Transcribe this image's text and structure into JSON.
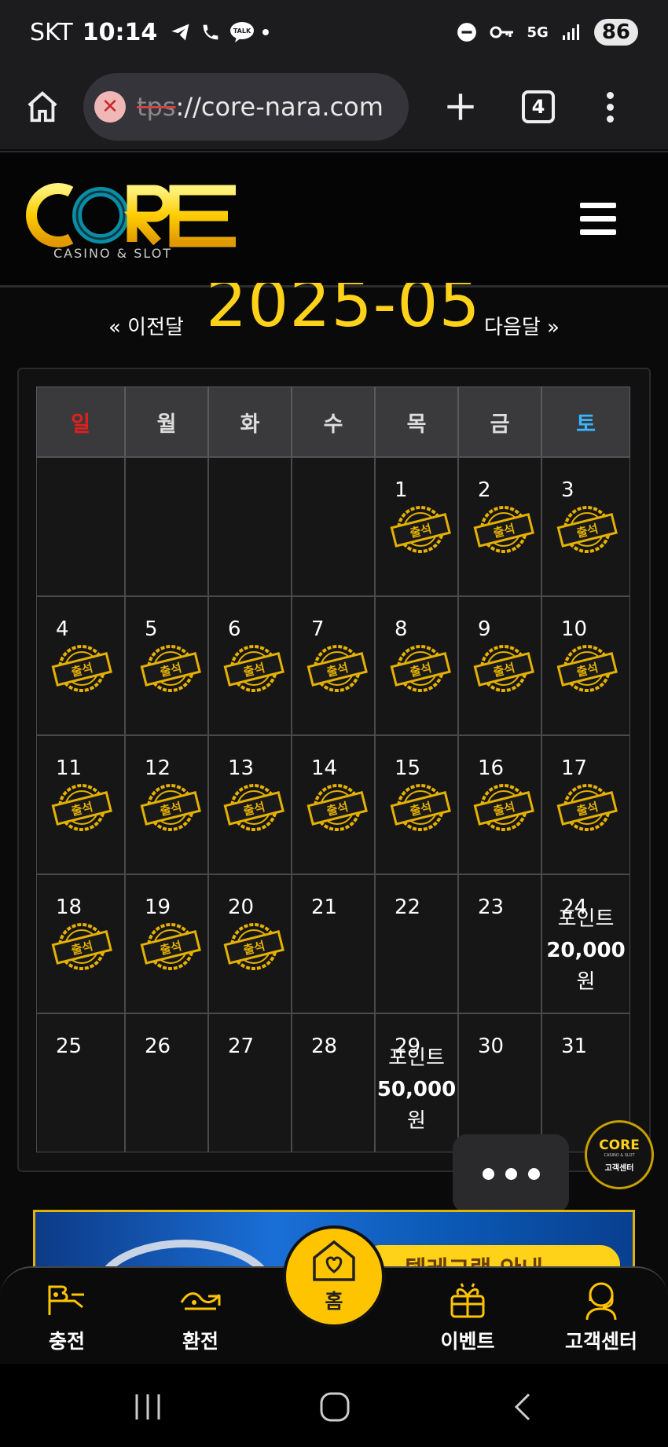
{
  "status_bar": {
    "carrier": "SKT",
    "time": "10:14",
    "network": "5G",
    "battery": "86"
  },
  "browser": {
    "url_faded": "tps",
    "url_main": "://core-nara.com",
    "tab_count": "4"
  },
  "site": {
    "logo_text": "CORE",
    "logo_subtitle": "CASINO & SLOT"
  },
  "calendar": {
    "prev_label": "« 이전달",
    "next_label": "다음달 »",
    "month_title": "2025-05",
    "weekdays": [
      "일",
      "월",
      "화",
      "수",
      "목",
      "금",
      "토"
    ],
    "weekday_colors": {
      "sunday": "#e0201e",
      "saturday": "#38b6ff",
      "default": "#dddddd"
    },
    "stamp_text": "출석",
    "days": [
      "1",
      "2",
      "3",
      "4",
      "5",
      "6",
      "7",
      "8",
      "9",
      "10",
      "11",
      "12",
      "13",
      "14",
      "15",
      "16",
      "17",
      "18",
      "19",
      "20",
      "21",
      "22",
      "23",
      "24",
      "25",
      "26",
      "27",
      "28",
      "29",
      "30",
      "31"
    ],
    "attended_through": 20,
    "rewards": {
      "24": {
        "label": "포인트",
        "amount": "20,000",
        "unit": "원"
      },
      "29": {
        "label": "포인트",
        "amount": "50,000",
        "unit": "원"
      }
    }
  },
  "floating": {
    "cs_badge_logo": "CORE",
    "cs_badge_sub": "CASINO & SLOT",
    "cs_badge_label": "고객센터"
  },
  "banner": {
    "text": "텔레그램 안내"
  },
  "bottom_nav": {
    "deposit": "충전",
    "withdraw": "환전",
    "home": "홈",
    "events": "이벤트",
    "support": "고객센터"
  },
  "colors": {
    "accent_gold": "#ffd21a",
    "background": "#0a0a0a"
  }
}
